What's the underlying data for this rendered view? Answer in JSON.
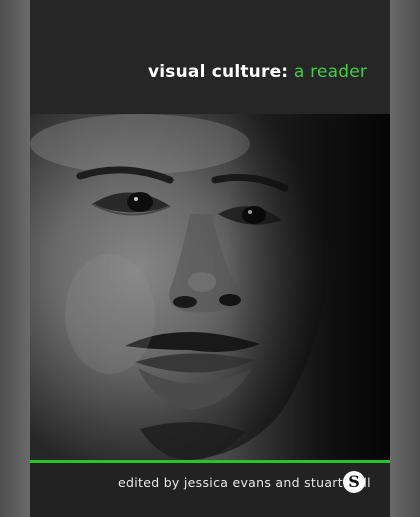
{
  "cover": {
    "title_bold": "visual culture:",
    "title_light": " a reader",
    "credit": "edited by jessica evans and stuart hall",
    "publisher_logo_letter": "S"
  },
  "colors": {
    "accent_green": "#27c427",
    "title_green": "#3ed03e",
    "background": "#232323"
  },
  "icons": {
    "publisher": "sage-publisher-logo-icon"
  }
}
